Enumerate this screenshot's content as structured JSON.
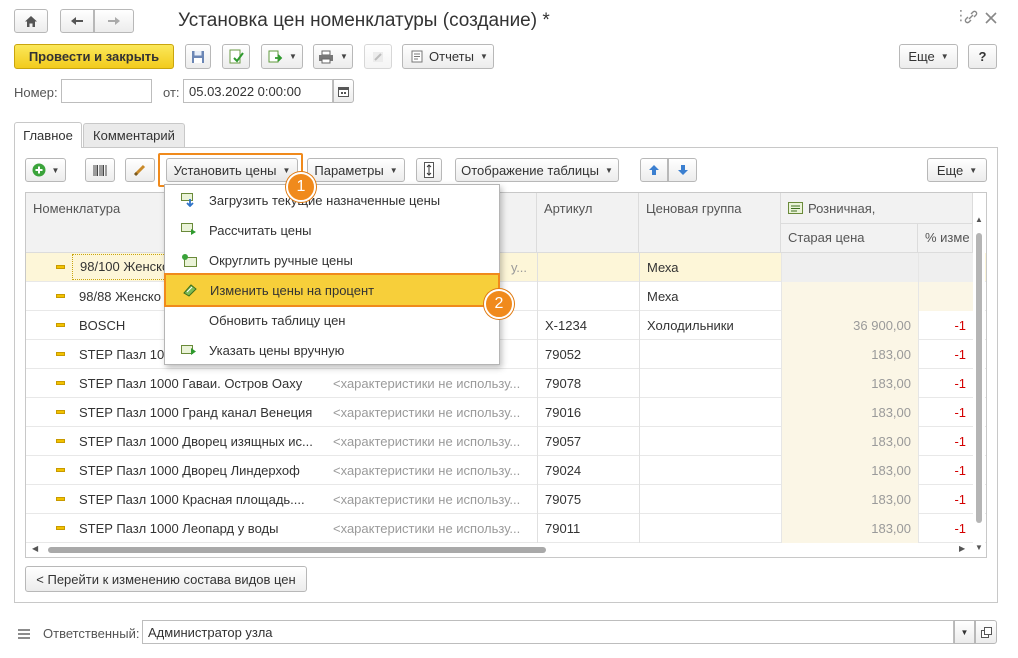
{
  "window": {
    "title": "Установка цен номенклатуры (создание) *",
    "icons": [
      "home-icon",
      "arrow-left-icon",
      "arrow-right-icon",
      "more-vert-icon",
      "link-icon",
      "maximize-icon",
      "close-icon"
    ]
  },
  "toolbar": {
    "post_close_label": "Провести и закрыть",
    "reports_label": "Отчеты",
    "more_label": "Еще",
    "help_label": "?"
  },
  "header": {
    "number_label": "Номер:",
    "number_value": "",
    "from_label": "от:",
    "date_value": "05.03.2022  0:00:00"
  },
  "tabs": [
    {
      "label": "Главное",
      "active": true
    },
    {
      "label": "Комментарий",
      "active": false
    }
  ],
  "table_toolbar": {
    "set_prices_label": "Установить цены",
    "params_label": "Параметры",
    "display_label": "Отображение таблицы",
    "more_label": "Еще"
  },
  "grid": {
    "columns": {
      "nomenclature": "Номенклатура",
      "article": "Артикул",
      "price_group": "Ценовая группа",
      "retail": "Розничная,",
      "old_price": "Старая цена",
      "percent": "% изме"
    },
    "rows": [
      {
        "name": "98/100 Женско",
        "char": "",
        "article": "",
        "group": "Меха",
        "old": "",
        "pct": ""
      },
      {
        "name": "98/88 Женско",
        "char": "",
        "article": "",
        "group": "Меха",
        "old": "",
        "pct": ""
      },
      {
        "name": "BOSCH",
        "char": "",
        "article": "X-1234",
        "group": "Холодильники",
        "old": "36 900,00",
        "pct": "-1"
      },
      {
        "name": "STEP Пазл 10",
        "char": "",
        "article": "79052",
        "group": "",
        "old": "183,00",
        "pct": "-1"
      },
      {
        "name": "STEP Пазл 1000 Гаваи. Остров Оаху",
        "char": "<характеристики не использу...",
        "article": "79078",
        "group": "",
        "old": "183,00",
        "pct": "-1"
      },
      {
        "name": "STEP Пазл 1000 Гранд канал Венеция",
        "char": "<характеристики не использу...",
        "article": "79016",
        "group": "",
        "old": "183,00",
        "pct": "-1"
      },
      {
        "name": "STEP Пазл 1000 Дворец изящных ис...",
        "char": "<характеристики не использу...",
        "article": "79057",
        "group": "",
        "old": "183,00",
        "pct": "-1"
      },
      {
        "name": "STEP Пазл 1000 Дворец Линдерхоф",
        "char": "<характеристики не использу...",
        "article": "79024",
        "group": "",
        "old": "183,00",
        "pct": "-1"
      },
      {
        "name": "STEP Пазл 1000 Красная площадь....",
        "char": "<характеристики не использу...",
        "article": "79075",
        "group": "",
        "old": "183,00",
        "pct": "-1"
      },
      {
        "name": "STEP Пазл 1000 Леопард у воды",
        "char": "<характеристики не использу...",
        "article": "79011",
        "group": "",
        "old": "183,00",
        "pct": "-1"
      }
    ],
    "partial_char_row0": "у..."
  },
  "menu": {
    "items": [
      {
        "label": "Загрузить текущие назначенные цены",
        "icon": "load-prices-icon"
      },
      {
        "label": "Рассчитать цены",
        "icon": "calculate-icon"
      },
      {
        "label": "Округлить ручные цены",
        "icon": "round-icon"
      },
      {
        "label": "Изменить цены на процент",
        "icon": "percent-change-icon"
      },
      {
        "label": "Обновить таблицу цен",
        "icon": ""
      },
      {
        "label": "Указать цены вручную",
        "icon": "manual-prices-icon"
      }
    ]
  },
  "callouts": [
    "1",
    "2"
  ],
  "footer": {
    "go_label": "< Перейти к изменению состава видов цен",
    "responsible_label": "Ответственный:",
    "responsible_value": "Администратор узла"
  },
  "colors": {
    "accent": "#f08a1c",
    "yellow": "#f5d43a",
    "selection": "#fdf6d8"
  }
}
